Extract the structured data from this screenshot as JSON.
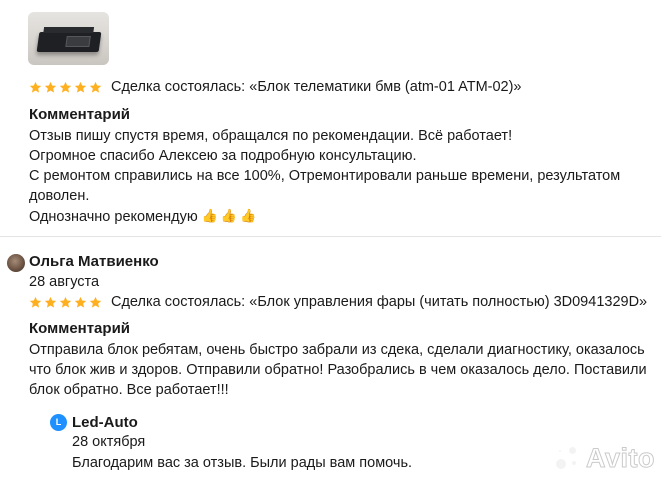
{
  "review1": {
    "deal_prefix": "Сделка состоялась:",
    "deal_item": "«Блок телематики бмв (atm-01 ATM-02)»",
    "comment_heading": "Комментарий",
    "lines": [
      "Отзыв пишу спустя время, обращался по рекомендации. Всё работает!",
      "Огромное спасибо Алексею за подробную консультацию.",
      "С ремонтом справились на все 100%, Отремонтировали раньше времени, результатом",
      "доволен.",
      "Однозначно рекомендую"
    ],
    "thumbs": "👍👍👍",
    "rating": 5
  },
  "review2": {
    "author": "Ольга Матвиенко",
    "date": "28 августа",
    "deal_prefix": "Сделка состоялась:",
    "deal_item": "«Блок управления фары (читать полностью) 3D0941329D»",
    "comment_heading": "Комментарий",
    "lines": [
      "Отправила блок ребятам, очень быстро забрали из сдека, сделали диагностику, оказалось",
      "что блок жив и здоров. Отправили обратно! Разобрались в чем оказалось дело. Поставили",
      "блок обратно. Все работает!!!"
    ],
    "rating": 5
  },
  "reply": {
    "avatar_letter": "L",
    "author": "Led-Auto",
    "date": "28 октября",
    "text": "Благодарим вас за отзыв. Были рады вам помочь."
  },
  "watermark": {
    "text": "Avito"
  },
  "colors": {
    "star": "#ffb021",
    "reply_avatar": "#1e90ff"
  }
}
